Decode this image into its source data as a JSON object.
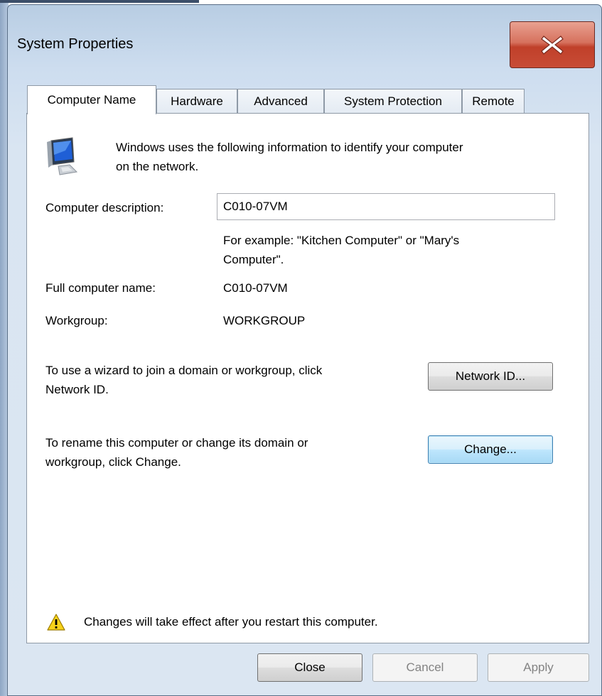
{
  "window": {
    "title": "System Properties"
  },
  "tabs": [
    {
      "label": "Computer Name",
      "active": true
    },
    {
      "label": "Hardware",
      "active": false
    },
    {
      "label": "Advanced",
      "active": false
    },
    {
      "label": "System Protection",
      "active": false
    },
    {
      "label": "Remote",
      "active": false
    }
  ],
  "intro": {
    "line1": "Windows uses the following information to identify your computer",
    "line2": "on the network."
  },
  "fields": {
    "description_label": "Computer description:",
    "description_value": "C010-07VM",
    "example_line1": "For example: \"Kitchen Computer\" or \"Mary's",
    "example_line2": "Computer\".",
    "full_name_label": "Full computer name:",
    "full_name_value": "C010-07VM",
    "workgroup_label": "Workgroup:",
    "workgroup_value": "WORKGROUP"
  },
  "network_id": {
    "text_line1": "To use a wizard to join a domain or workgroup, click",
    "text_line2": "Network ID.",
    "button_label": "Network ID..."
  },
  "change": {
    "text_line1": "To rename this computer or change its domain or",
    "text_line2": "workgroup, click Change.",
    "button_label": "Change..."
  },
  "warning": {
    "text": "Changes will take effect after you restart this computer."
  },
  "footer": {
    "close_label": "Close",
    "cancel_label": "Cancel",
    "apply_label": "Apply"
  },
  "icons": {
    "computer": "computer-icon",
    "warning": "warning-icon",
    "close": "close-icon"
  },
  "colors": {
    "close_button": "#c84c36",
    "focus_border": "#3c7fb1"
  }
}
